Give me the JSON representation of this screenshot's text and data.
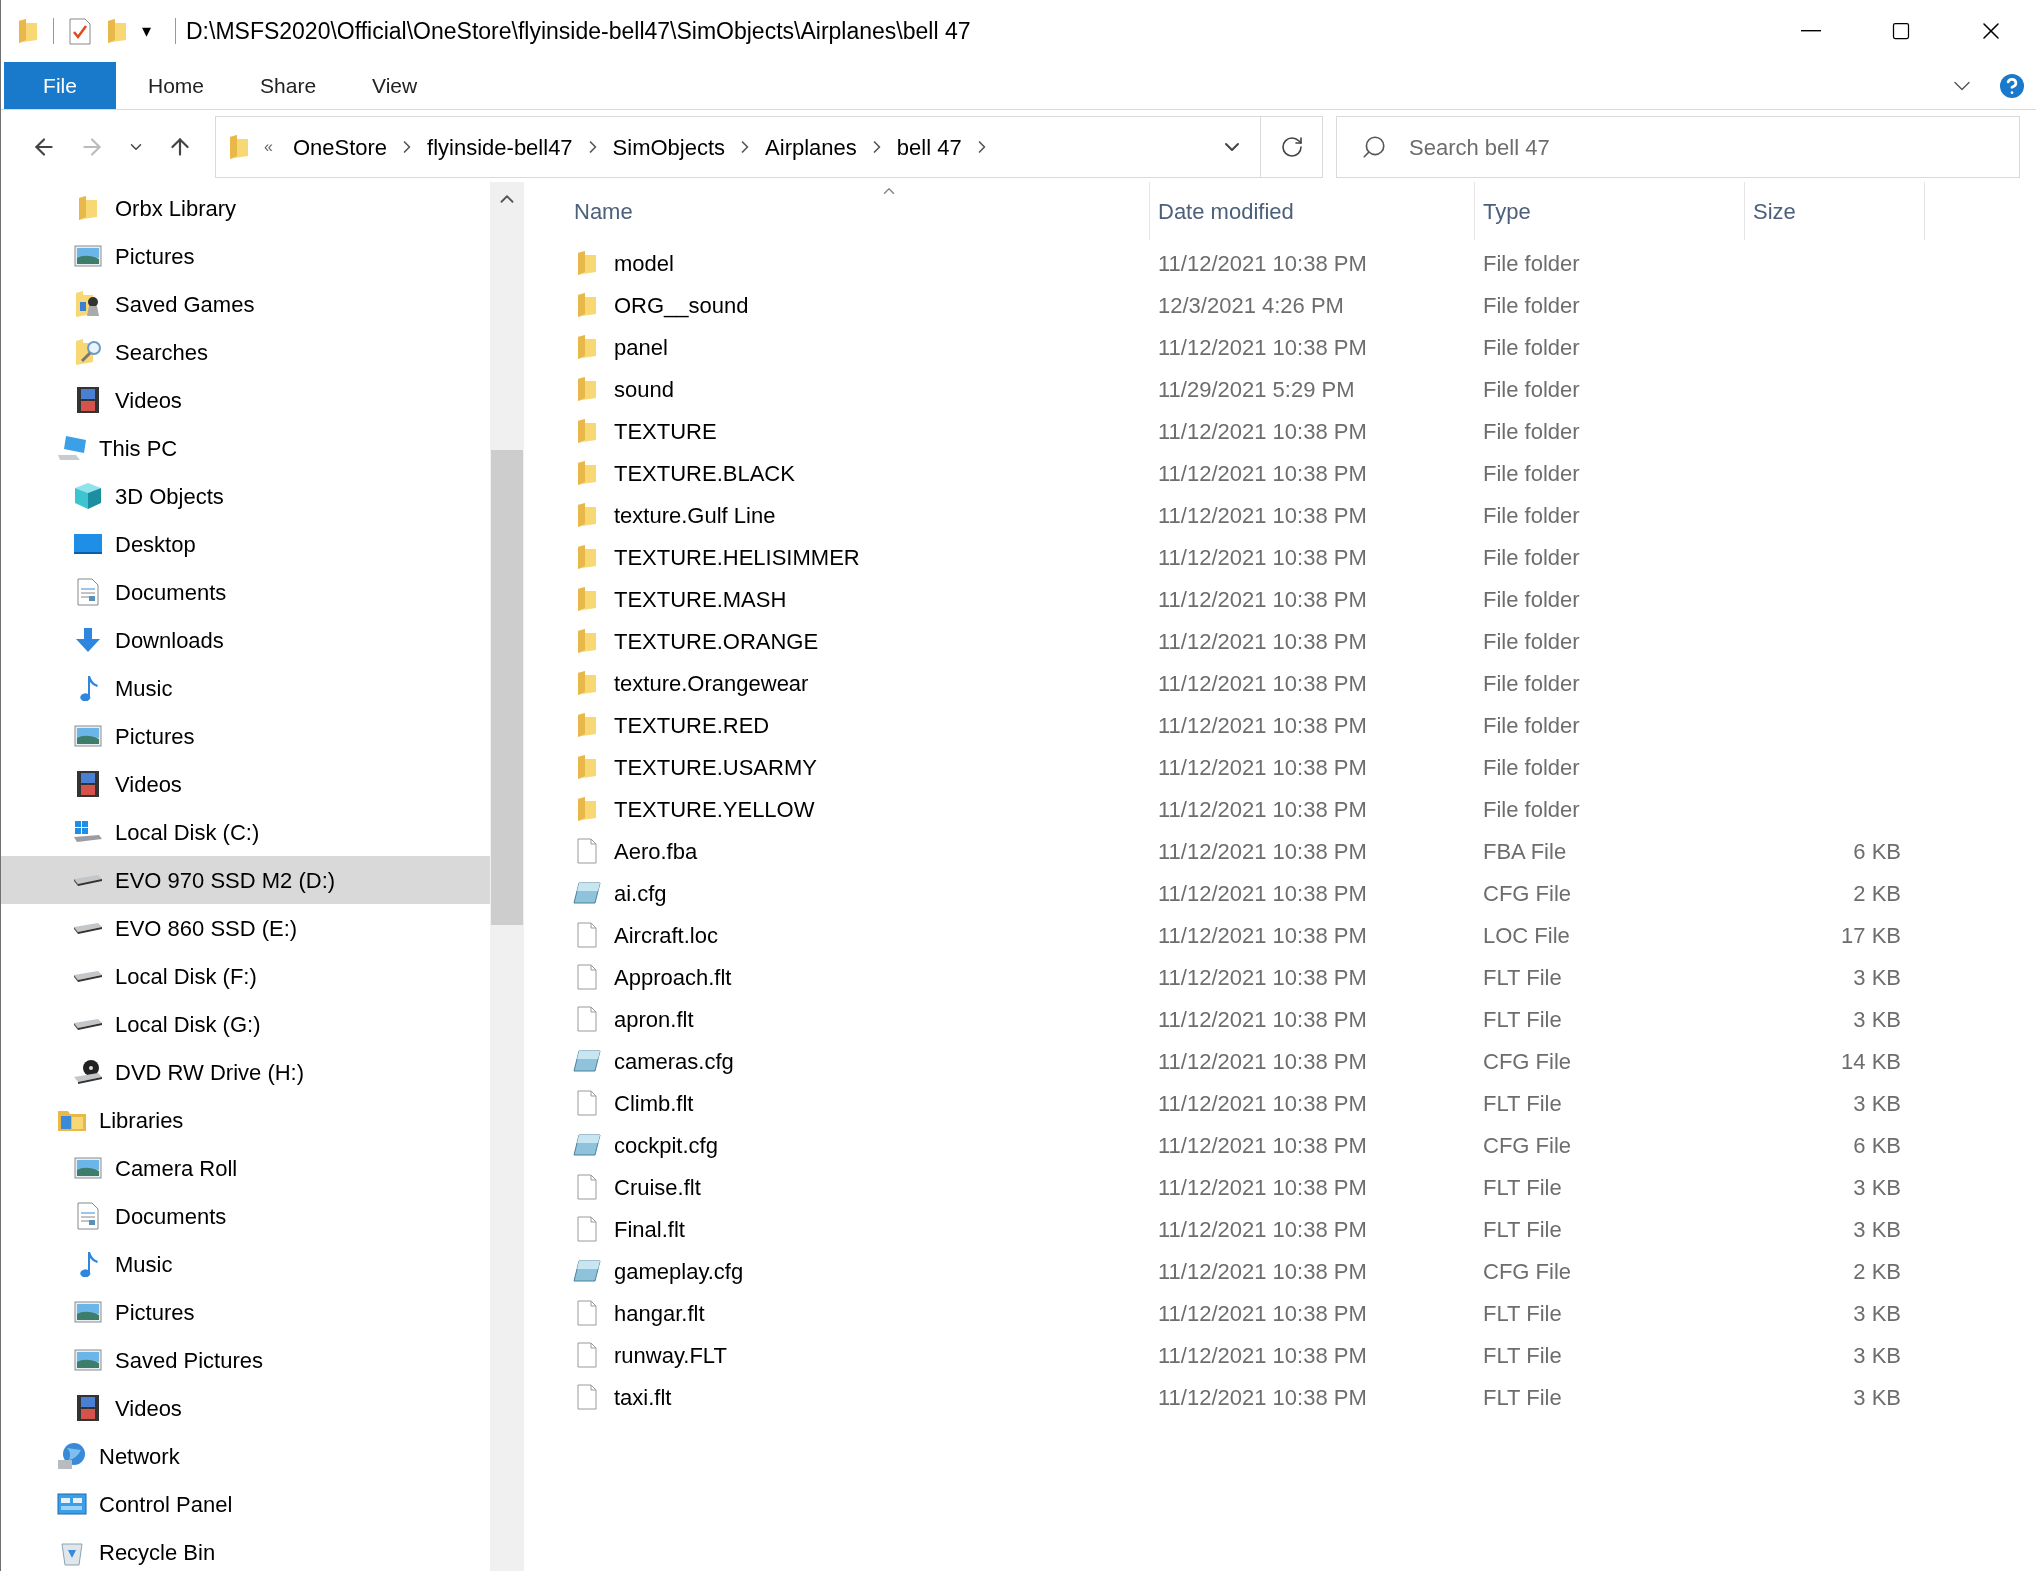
{
  "window": {
    "title": "D:\\MSFS2020\\Official\\OneStore\\flyinside-bell47\\SimObjects\\Airplanes\\bell 47",
    "quick_access_arrow": "▾"
  },
  "ribbon": {
    "tabs": [
      {
        "label": "File",
        "selected": true
      },
      {
        "label": "Home",
        "selected": false
      },
      {
        "label": "Share",
        "selected": false
      },
      {
        "label": "View",
        "selected": false
      }
    ]
  },
  "address": {
    "overflow": "«",
    "crumbs": [
      "OneStore",
      "flyinside-bell47",
      "SimObjects",
      "Airplanes",
      "bell 47"
    ]
  },
  "search": {
    "placeholder": "Search bell 47"
  },
  "sidebar": {
    "continued_items": [
      {
        "label": "Orbx Library",
        "kind": "folder",
        "selected": false
      },
      {
        "label": "Pictures",
        "kind": "pictures",
        "selected": false
      },
      {
        "label": "Saved Games",
        "kind": "games",
        "selected": false
      },
      {
        "label": "Searches",
        "kind": "searches",
        "selected": false
      },
      {
        "label": "Videos",
        "kind": "videos",
        "selected": false
      }
    ],
    "items": [
      {
        "label": "This PC",
        "kind": "pc",
        "selected": false,
        "children": [
          {
            "label": "3D Objects",
            "kind": "objects",
            "selected": false
          },
          {
            "label": "Desktop",
            "kind": "desktop",
            "selected": false
          },
          {
            "label": "Documents",
            "kind": "documents",
            "selected": false
          },
          {
            "label": "Downloads",
            "kind": "downloads",
            "selected": false
          },
          {
            "label": "Music",
            "kind": "music",
            "selected": false
          },
          {
            "label": "Pictures",
            "kind": "pictures",
            "selected": false
          },
          {
            "label": "Videos",
            "kind": "videos",
            "selected": false
          },
          {
            "label": "Local Disk (C:)",
            "kind": "windrive",
            "selected": false
          },
          {
            "label": "EVO 970 SSD M2 (D:)",
            "kind": "drive",
            "selected": true
          },
          {
            "label": "EVO 860 SSD (E:)",
            "kind": "drive",
            "selected": false
          },
          {
            "label": "Local Disk (F:)",
            "kind": "drive",
            "selected": false
          },
          {
            "label": "Local Disk (G:)",
            "kind": "drive",
            "selected": false
          },
          {
            "label": "DVD RW Drive (H:)",
            "kind": "dvd",
            "selected": false
          }
        ]
      },
      {
        "label": "Libraries",
        "kind": "library",
        "selected": false,
        "children": [
          {
            "label": "Camera Roll",
            "kind": "pictures",
            "selected": false
          },
          {
            "label": "Documents",
            "kind": "documents",
            "selected": false
          },
          {
            "label": "Music",
            "kind": "music",
            "selected": false
          },
          {
            "label": "Pictures",
            "kind": "pictures",
            "selected": false
          },
          {
            "label": "Saved Pictures",
            "kind": "pictures",
            "selected": false
          },
          {
            "label": "Videos",
            "kind": "videos",
            "selected": false
          }
        ]
      },
      {
        "label": "Network",
        "kind": "network",
        "selected": false
      },
      {
        "label": "Control Panel",
        "kind": "control",
        "selected": false
      },
      {
        "label": "Recycle Bin",
        "kind": "recycle",
        "selected": false
      }
    ]
  },
  "table": {
    "columns": [
      "Name",
      "Date modified",
      "Type",
      "Size"
    ],
    "rows": [
      {
        "name": "model",
        "date": "11/12/2021 10:38 PM",
        "type": "File folder",
        "kind": "folder"
      },
      {
        "name": "ORG__sound",
        "date": "12/3/2021 4:26 PM",
        "type": "File folder",
        "kind": "folder"
      },
      {
        "name": "panel",
        "date": "11/12/2021 10:38 PM",
        "type": "File folder",
        "kind": "folder"
      },
      {
        "name": "sound",
        "date": "11/29/2021 5:29 PM",
        "type": "File folder",
        "kind": "folder"
      },
      {
        "name": "TEXTURE",
        "date": "11/12/2021 10:38 PM",
        "type": "File folder",
        "kind": "folder"
      },
      {
        "name": "TEXTURE.BLACK",
        "date": "11/12/2021 10:38 PM",
        "type": "File folder",
        "kind": "folder"
      },
      {
        "name": "texture.Gulf Line",
        "date": "11/12/2021 10:38 PM",
        "type": "File folder",
        "kind": "folder"
      },
      {
        "name": "TEXTURE.HELISIMMER",
        "date": "11/12/2021 10:38 PM",
        "type": "File folder",
        "kind": "folder"
      },
      {
        "name": "TEXTURE.MASH",
        "date": "11/12/2021 10:38 PM",
        "type": "File folder",
        "kind": "folder"
      },
      {
        "name": "TEXTURE.ORANGE",
        "date": "11/12/2021 10:38 PM",
        "type": "File folder",
        "kind": "folder"
      },
      {
        "name": "texture.Orangewear",
        "date": "11/12/2021 10:38 PM",
        "type": "File folder",
        "kind": "folder"
      },
      {
        "name": "TEXTURE.RED",
        "date": "11/12/2021 10:38 PM",
        "type": "File folder",
        "kind": "folder"
      },
      {
        "name": "TEXTURE.USARMY",
        "date": "11/12/2021 10:38 PM",
        "type": "File folder",
        "kind": "folder"
      },
      {
        "name": "TEXTURE.YELLOW",
        "date": "11/12/2021 10:38 PM",
        "type": "File folder",
        "kind": "folder"
      },
      {
        "name": "Aero.fba",
        "date": "11/12/2021 10:38 PM",
        "type": "FBA File",
        "size": "6 KB",
        "kind": "file"
      },
      {
        "name": "ai.cfg",
        "date": "11/12/2021 10:38 PM",
        "type": "CFG File",
        "size": "2 KB",
        "kind": "config"
      },
      {
        "name": "Aircraft.loc",
        "date": "11/12/2021 10:38 PM",
        "type": "LOC File",
        "size": "17 KB",
        "kind": "file"
      },
      {
        "name": "Approach.flt",
        "date": "11/12/2021 10:38 PM",
        "type": "FLT File",
        "size": "3 KB",
        "kind": "file"
      },
      {
        "name": "apron.flt",
        "date": "11/12/2021 10:38 PM",
        "type": "FLT File",
        "size": "3 KB",
        "kind": "file"
      },
      {
        "name": "cameras.cfg",
        "date": "11/12/2021 10:38 PM",
        "type": "CFG File",
        "size": "14 KB",
        "kind": "config"
      },
      {
        "name": "Climb.flt",
        "date": "11/12/2021 10:38 PM",
        "type": "FLT File",
        "size": "3 KB",
        "kind": "file"
      },
      {
        "name": "cockpit.cfg",
        "date": "11/12/2021 10:38 PM",
        "type": "CFG File",
        "size": "6 KB",
        "kind": "config"
      },
      {
        "name": "Cruise.flt",
        "date": "11/12/2021 10:38 PM",
        "type": "FLT File",
        "size": "3 KB",
        "kind": "file"
      },
      {
        "name": "Final.flt",
        "date": "11/12/2021 10:38 PM",
        "type": "FLT File",
        "size": "3 KB",
        "kind": "file"
      },
      {
        "name": "gameplay.cfg",
        "date": "11/12/2021 10:38 PM",
        "type": "CFG File",
        "size": "2 KB",
        "kind": "config"
      },
      {
        "name": "hangar.flt",
        "date": "11/12/2021 10:38 PM",
        "type": "FLT File",
        "size": "3 KB",
        "kind": "file"
      },
      {
        "name": "runway.FLT",
        "date": "11/12/2021 10:38 PM",
        "type": "FLT File",
        "size": "3 KB",
        "kind": "file"
      },
      {
        "name": "taxi.flt",
        "date": "11/12/2021 10:38 PM",
        "type": "FLT File",
        "size": "3 KB",
        "kind": "file"
      }
    ]
  }
}
